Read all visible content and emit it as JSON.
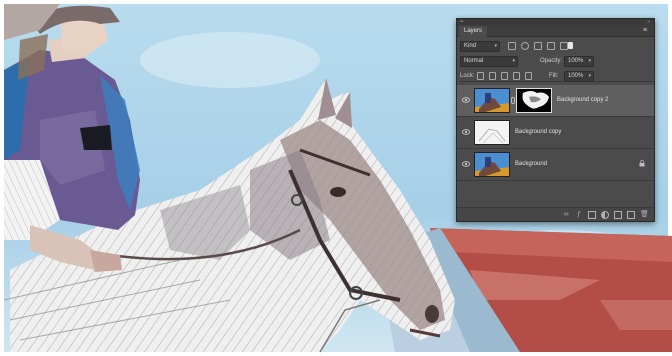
{
  "panel": {
    "title": "Layers",
    "menu_icon": "panel-menu-icon",
    "filter": {
      "kind_label": "Kind"
    },
    "blend_mode": "Normal",
    "opacity_label": "Opacity:",
    "opacity_value": "100%",
    "lock_label": "Lock:",
    "fill_label": "Fill:",
    "fill_value": "100%",
    "layers": [
      {
        "name": "Background copy 2",
        "visible": true,
        "selected": true,
        "has_mask": true
      },
      {
        "name": "Background copy",
        "visible": true,
        "selected": false,
        "has_mask": false
      },
      {
        "name": "Background",
        "visible": true,
        "selected": false,
        "locked": true
      }
    ],
    "footer_icons": [
      "link-layers-icon",
      "fx-icon",
      "add-mask-icon",
      "adjustment-layer-icon",
      "new-group-icon",
      "new-layer-icon",
      "delete-layer-icon"
    ]
  },
  "colors": {
    "panel_bg": "#4b4b4b",
    "panel_selected_row": "#5f5f5f",
    "sky": "#a8cfe6",
    "roof": "#b8504a"
  }
}
